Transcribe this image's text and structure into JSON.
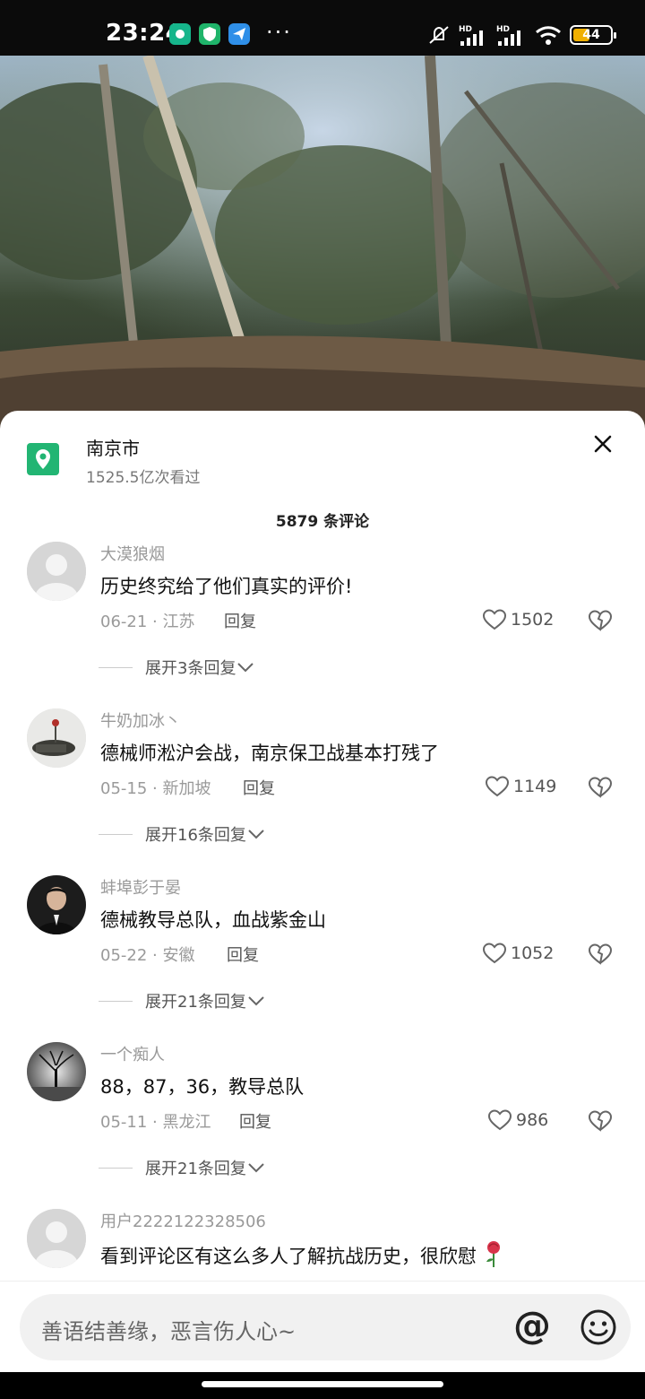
{
  "status_bar": {
    "time": "23:24",
    "more": "···",
    "battery": "44",
    "icons": [
      "app-icon-1",
      "app-icon-2",
      "app-icon-3",
      "mute-icon",
      "signal-icon",
      "signal-icon",
      "wifi-icon",
      "battery-icon"
    ]
  },
  "location": {
    "title": "南京市",
    "views": "1525.5亿次看过",
    "icon": "location-pin-icon"
  },
  "comment_count": "5879 条评论",
  "comments": [
    {
      "user": "大漠狼烟",
      "text": "历史终究给了他们真实的评价!",
      "meta": "06-21 · 江苏",
      "reply": "回复",
      "likes": "1502",
      "expand": "展开3条回复"
    },
    {
      "user": "牛奶加冰丶",
      "text": "德械师淞沪会战，南京保卫战基本打残了",
      "meta": "05-15 · 新加坡",
      "reply": "回复",
      "likes": "1149",
      "expand": "展开16条回复"
    },
    {
      "user": "蚌埠彭于晏",
      "text": "德械教导总队，血战紫金山",
      "meta": "05-22 · 安徽",
      "reply": "回复",
      "likes": "1052",
      "expand": "展开21条回复"
    },
    {
      "user": "一个痴人",
      "text": "88，87，36，教导总队",
      "meta": "05-11 · 黑龙江",
      "reply": "回复",
      "likes": "986",
      "expand": "展开21条回复"
    },
    {
      "user": "用户2222122328506",
      "text": "看到评论区有这么多人了解抗战历史，很欣慰"
    }
  ],
  "input": {
    "placeholder": "善语结善缘，恶言伤人心~",
    "at_symbol": "@"
  }
}
